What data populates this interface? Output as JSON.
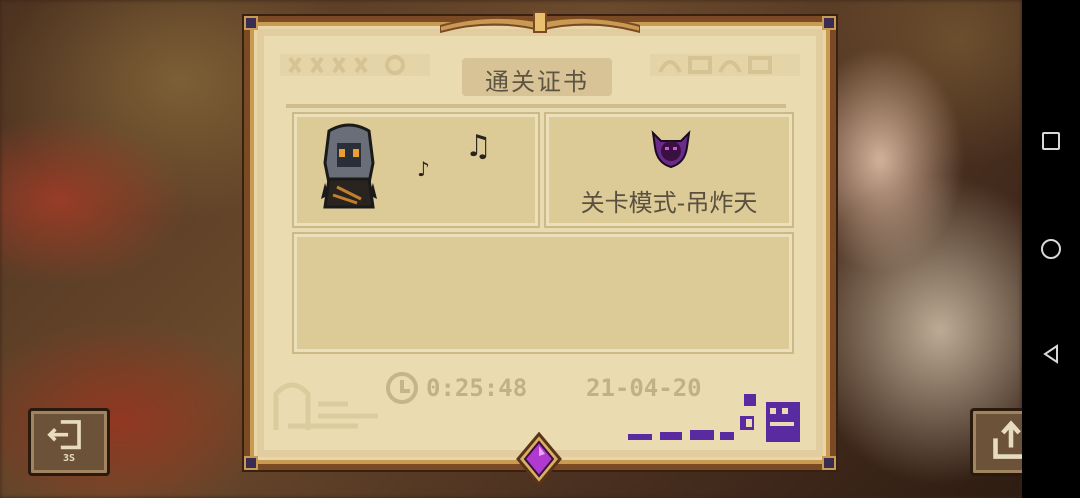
{
  "certificate": {
    "title": "通关证书",
    "mode_label": "关卡模式-吊炸天",
    "time": "0:25:48",
    "date": "21-04-20"
  },
  "exit_button": {
    "countdown": "3S",
    "icon": "exit-door-icon"
  },
  "share_button": {
    "icon": "share-icon"
  },
  "icons": {
    "character": "hooded-character-sprite",
    "music_notes": "music-note-icon",
    "mode_icon": "demon-horns-icon",
    "clock": "clock-icon",
    "gem": "purple-gem-icon"
  },
  "nav_bar": {
    "recent": "recent-apps-icon",
    "home": "home-circle-icon",
    "back": "back-triangle-icon"
  },
  "colors": {
    "panel": "#e2cda0",
    "frame": "#7a4a24",
    "mode_icon": "#6a2a8a",
    "gem": "#b03ad0",
    "signature": "#5a2aa0"
  }
}
